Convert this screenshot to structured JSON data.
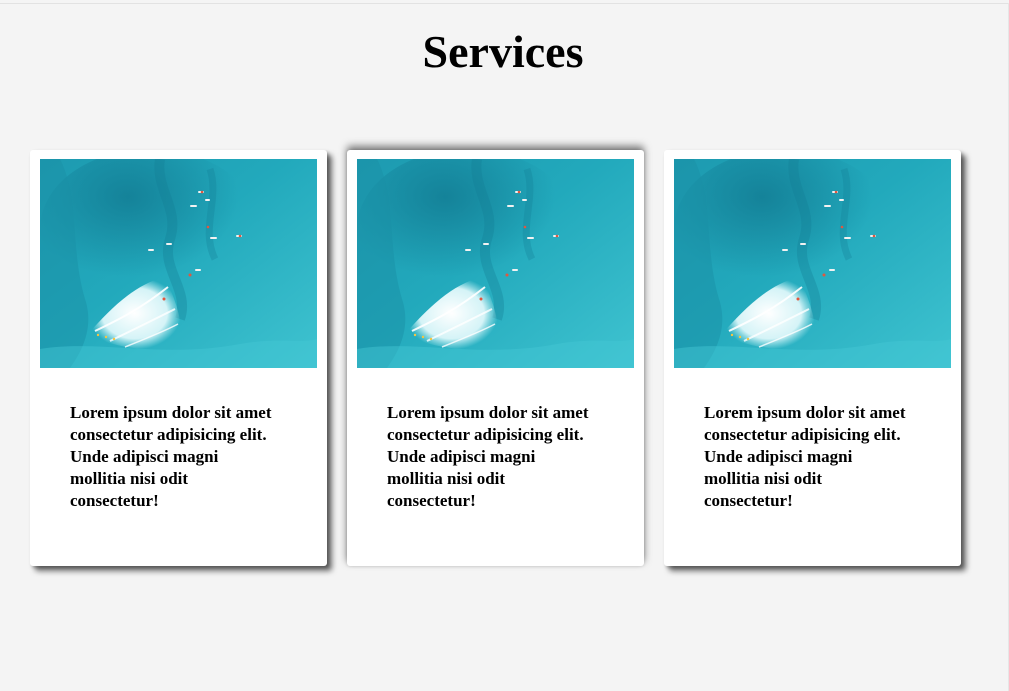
{
  "page": {
    "title": "Services"
  },
  "colors": {
    "background": "#f4f4f4",
    "card": "#ffffff",
    "water_dark": "#1796ad",
    "water_light": "#3fc5d2",
    "foam": "#ffffff"
  },
  "cards": [
    {
      "image_icon": "ocean-surfers-aerial-image",
      "text": "Lorem ipsum dolor sit amet consectetur adipisicing elit. Unde adipisci magni mollitia nisi odit consectetur!"
    },
    {
      "image_icon": "ocean-surfers-aerial-image",
      "text": "Lorem ipsum dolor sit amet consectetur adipisicing elit. Unde adipisci magni mollitia nisi odit consectetur!"
    },
    {
      "image_icon": "ocean-surfers-aerial-image",
      "text": "Lorem ipsum dolor sit amet consectetur adipisicing elit. Unde adipisci magni mollitia nisi odit consectetur!"
    }
  ]
}
